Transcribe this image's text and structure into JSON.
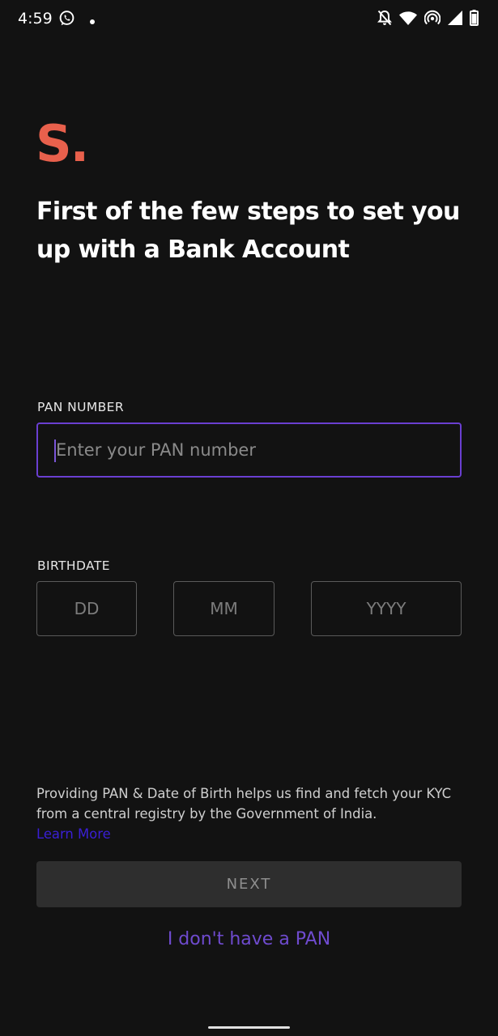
{
  "status_bar": {
    "time": "4:59",
    "left_icons": [
      "whatsapp-icon",
      "notification-dot-icon"
    ],
    "right_icons": [
      "do-not-disturb-icon",
      "wifi-icon",
      "hotspot-icon",
      "cellular-signal-icon",
      "battery-icon"
    ]
  },
  "brand": {
    "logo_text": "S.",
    "logo_color": "#e8604c"
  },
  "headline": "First of the few steps to set you up with a Bank Account",
  "pan": {
    "label": "PAN NUMBER",
    "placeholder": "Enter your PAN number",
    "value": ""
  },
  "birthdate": {
    "label": "BIRTHDATE",
    "day_placeholder": "DD",
    "month_placeholder": "MM",
    "year_placeholder": "YYYY"
  },
  "info": {
    "text": "Providing PAN & Date of Birth helps us find and fetch your KYC from a central registry by the Government of India.",
    "link_label": "Learn More"
  },
  "actions": {
    "next_label": "NEXT",
    "no_pan_label": "I don't have a PAN"
  },
  "colors": {
    "background": "#121212",
    "accent": "#6a3fd1",
    "link": "#3a1fd6"
  }
}
